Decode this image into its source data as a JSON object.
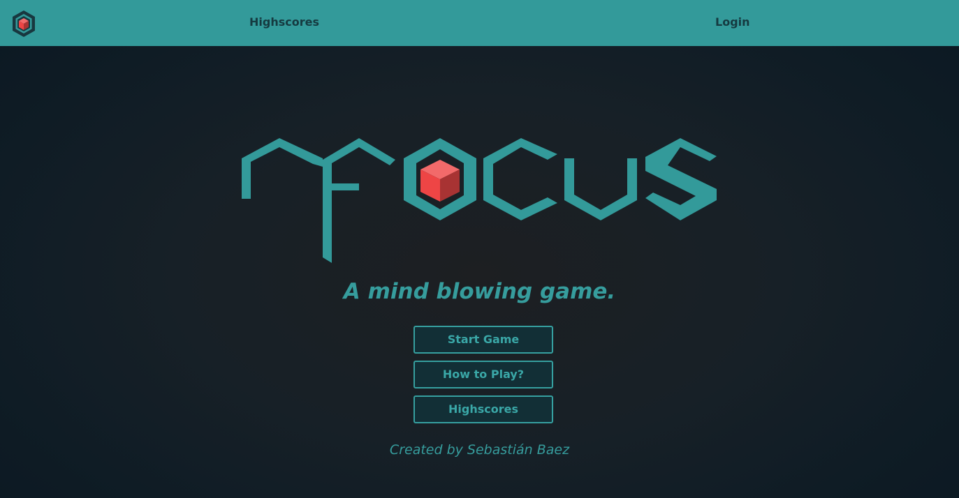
{
  "nav": {
    "logo_icon": "hexagon-cube-icon",
    "highscores_label": "Highscores",
    "login_label": "Login"
  },
  "hero": {
    "logo_text": "nfocus",
    "tagline": "A mind blowing game."
  },
  "menu": {
    "start_label": "Start Game",
    "how_label": "How to Play?",
    "highscores_label": "Highscores"
  },
  "footer": {
    "credit": "Created by Sebastián Baez"
  },
  "colors": {
    "accent": "#339a9a",
    "nav_text": "#153a40",
    "cube_top": "#f26a6a",
    "cube_left": "#ee4545",
    "cube_right": "#a83333",
    "background": "#141d24"
  }
}
